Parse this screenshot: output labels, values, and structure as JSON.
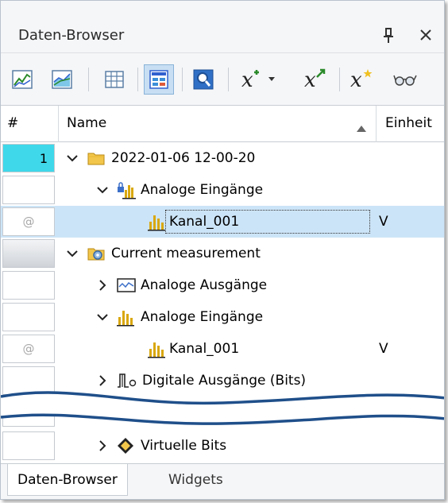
{
  "window": {
    "title": "Daten-Browser"
  },
  "toolbar": {
    "buttons": [
      {
        "icon": "line-chart-icon"
      },
      {
        "icon": "area-chart-icon"
      },
      {
        "icon": "table-grid-icon"
      },
      {
        "icon": "channel-panel-icon",
        "active": true
      },
      {
        "icon": "search-zoom-icon"
      },
      {
        "icon": "formula-x-add-icon"
      },
      {
        "icon": "formula-x-arrow-icon"
      },
      {
        "icon": "formula-x-star-icon"
      },
      {
        "icon": "glasses-icon"
      }
    ]
  },
  "columns": {
    "num": "#",
    "name": "Name",
    "unit": "Einheit"
  },
  "rows": [
    {
      "num": "1",
      "label": "2022-01-06 12-00-20",
      "unit": ""
    },
    {
      "num": "",
      "label": "Analoge Eingänge",
      "unit": ""
    },
    {
      "num": "@",
      "label": "Kanal_001",
      "unit": "V"
    },
    {
      "num": "",
      "label": "Current measurement",
      "unit": ""
    },
    {
      "num": "",
      "label": "Analoge Ausgänge",
      "unit": ""
    },
    {
      "num": "",
      "label": "Analoge Eingänge",
      "unit": ""
    },
    {
      "num": "@",
      "label": "Kanal_001",
      "unit": "V"
    },
    {
      "num": "",
      "label": "Digitale Ausgänge (Bits)",
      "unit": ""
    },
    {
      "num": "",
      "label": "",
      "unit": ""
    },
    {
      "num": "",
      "label": "Virtuelle Bits",
      "unit": ""
    }
  ],
  "tabs": [
    {
      "label": "Daten-Browser",
      "active": true
    },
    {
      "label": "Widgets",
      "active": false
    }
  ],
  "colors": {
    "selection": "#cce4f7",
    "number_badge": "#3fd8ea",
    "wave": "#1f4f8a"
  }
}
